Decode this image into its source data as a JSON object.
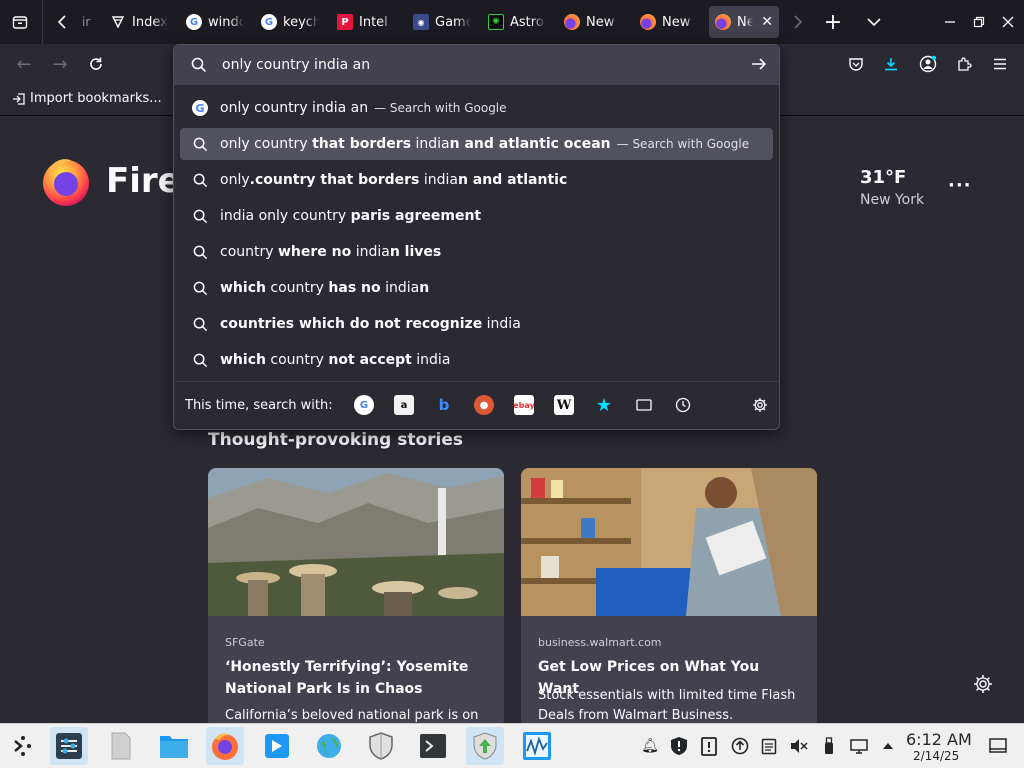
{
  "tabs": [
    {
      "title": "Index",
      "favicon": "index-icon"
    },
    {
      "title": "windows",
      "favicon": "google-icon"
    },
    {
      "title": "keychain",
      "favicon": "google-icon"
    },
    {
      "title": "Intel",
      "favicon": "pcmag-icon"
    },
    {
      "title": "Games",
      "favicon": "game-icon"
    },
    {
      "title": "Astro",
      "favicon": "astro-icon"
    },
    {
      "title": "New",
      "favicon": "firefox-icon"
    },
    {
      "title": "New",
      "favicon": "firefox-icon"
    },
    {
      "title": "New",
      "favicon": "firefox-icon",
      "active": true
    }
  ],
  "toolbar": {
    "bookmark_import": "Import bookmarks..."
  },
  "urlbar": {
    "value": "only country india an",
    "suggestions": [
      {
        "parts": [
          {
            "t": "only country india an",
            "b": false
          }
        ],
        "action": "— Search with Google",
        "icon": "google-icon"
      },
      {
        "parts": [
          {
            "t": "only country ",
            "b": false
          },
          {
            "t": "that borders",
            "b": true
          },
          {
            "t": " india",
            "b": false
          },
          {
            "t": "n and atlantic ocean",
            "b": true
          }
        ],
        "action": "— Search with Google",
        "icon": "search-icon",
        "highlight": true
      },
      {
        "parts": [
          {
            "t": "only",
            "b": false
          },
          {
            "t": ".country that borders",
            "b": true
          },
          {
            "t": " india",
            "b": false
          },
          {
            "t": "n and atlantic",
            "b": true
          }
        ],
        "icon": "search-icon"
      },
      {
        "parts": [
          {
            "t": "india only country ",
            "b": false
          },
          {
            "t": "paris agreement",
            "b": true
          }
        ],
        "icon": "search-icon"
      },
      {
        "parts": [
          {
            "t": "country ",
            "b": false
          },
          {
            "t": "where no",
            "b": true
          },
          {
            "t": " india",
            "b": false
          },
          {
            "t": "n lives",
            "b": true
          }
        ],
        "icon": "search-icon"
      },
      {
        "parts": [
          {
            "t": "which",
            "b": true
          },
          {
            "t": " country ",
            "b": false
          },
          {
            "t": "has no",
            "b": true
          },
          {
            "t": " india",
            "b": false
          },
          {
            "t": "n",
            "b": true
          }
        ],
        "icon": "search-icon"
      },
      {
        "parts": [
          {
            "t": "countries which do not recognize",
            "b": true
          },
          {
            "t": " india",
            "b": false
          }
        ],
        "icon": "search-icon"
      },
      {
        "parts": [
          {
            "t": "which",
            "b": true
          },
          {
            "t": " country ",
            "b": false
          },
          {
            "t": "not accept",
            "b": true
          },
          {
            "t": " india",
            "b": false
          }
        ],
        "icon": "search-icon"
      }
    ],
    "oneoff_label": "This time, search with:",
    "engines": [
      "google",
      "amazon",
      "bing",
      "duckduckgo",
      "ebay",
      "wikipedia",
      "bookmarks",
      "tabs",
      "history"
    ]
  },
  "newtab": {
    "wordmark": "Firef",
    "weather_temp": "31°F",
    "weather_city": "New York",
    "stories_title": "Thought-provoking stories",
    "cards": [
      {
        "source": "SFGate",
        "headline": "‘Honestly Terrifying’: Yosemite National Park Is in Chaos",
        "excerpt": "California’s beloved national park is on"
      },
      {
        "source": "business.walmart.com",
        "headline": "Get Low Prices on What You Want",
        "excerpt": "Stock essentials with limited time Flash Deals from Walmart Business."
      }
    ]
  },
  "taskbar": {
    "time": "6:12 AM",
    "date": "2/14/25"
  },
  "colors": {
    "accent": "#0b74d4",
    "panel_bg": "#2b2a33",
    "tab_bg": "#1c1b22"
  }
}
